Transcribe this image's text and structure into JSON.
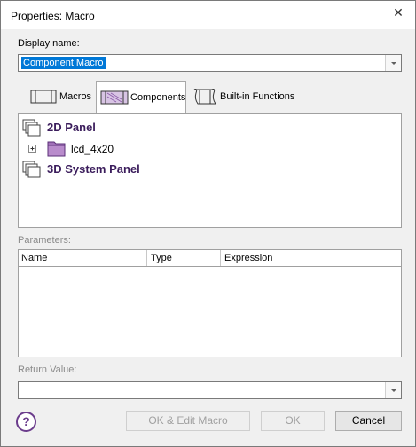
{
  "window": {
    "title": "Properties: Macro",
    "close_glyph": "✕"
  },
  "display_name": {
    "label": "Display name:",
    "value": "Component Macro"
  },
  "tabs": [
    {
      "label": "Macros",
      "icon": "macro-icon",
      "active": false
    },
    {
      "label": "Components",
      "icon": "components-icon",
      "active": true
    },
    {
      "label": "Built-in Functions",
      "icon": "builtin-functions-icon",
      "active": false
    }
  ],
  "tree": {
    "items": [
      {
        "label": "2D Panel",
        "icon": "panel-icon"
      },
      {
        "label": "lcd_4x20",
        "icon": "component-folder-icon",
        "expander": "+"
      },
      {
        "label": "3D System Panel",
        "icon": "panel-icon"
      }
    ]
  },
  "parameters": {
    "label": "Parameters:",
    "columns": [
      "Name",
      "Type",
      "Expression"
    ]
  },
  "return_value": {
    "label": "Return Value:",
    "value": ""
  },
  "buttons": {
    "help": "?",
    "ok_edit": "OK & Edit Macro",
    "ok": "OK",
    "cancel": "Cancel"
  },
  "colors": {
    "accent": "#6b3c8c",
    "selection": "#0078d7",
    "folder": "#a070b8"
  }
}
